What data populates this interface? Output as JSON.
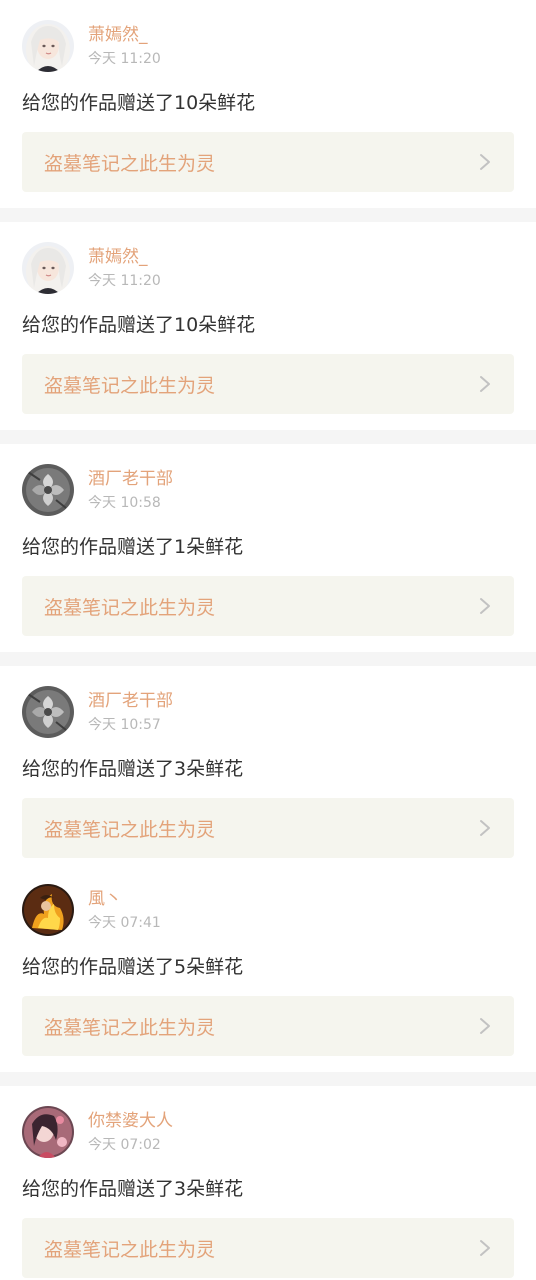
{
  "notifications": [
    {
      "user": "萧嫣然_",
      "time": "今天 11:20",
      "message": "给您的作品赠送了10朵鲜花",
      "book": "盗墓笔记之此生为灵",
      "avatar_icon": "avatar-white-hair-girl-icon"
    },
    {
      "user": "萧嫣然_",
      "time": "今天 11:20",
      "message": "给您的作品赠送了10朵鲜花",
      "book": "盗墓笔记之此生为灵",
      "avatar_icon": "avatar-white-hair-girl-icon"
    },
    {
      "user": "酒厂老干部",
      "time": "今天 10:58",
      "message": "给您的作品赠送了1朵鲜花",
      "book": "盗墓笔记之此生为灵",
      "avatar_icon": "avatar-gray-flower-icon"
    },
    {
      "user": "酒厂老干部",
      "time": "今天 10:57",
      "message": "给您的作品赠送了3朵鲜花",
      "book": "盗墓笔记之此生为灵",
      "avatar_icon": "avatar-gray-flower-icon"
    },
    {
      "user": "風丶",
      "time": "今天 07:41",
      "message": "给您的作品赠送了5朵鲜花",
      "book": "盗墓笔记之此生为灵",
      "avatar_icon": "avatar-fire-character-icon"
    },
    {
      "user": "你禁婆大人",
      "time": "今天 07:02",
      "message": "给您的作品赠送了3朵鲜花",
      "book": "盗墓笔记之此生为灵",
      "avatar_icon": "avatar-anime-girl-icon"
    }
  ],
  "colors": {
    "accent": "#e3a37a",
    "text": "#333333",
    "muted": "#b8b8b8",
    "book_bg": "#f5f5ee",
    "separator": "#f5f5f5"
  }
}
